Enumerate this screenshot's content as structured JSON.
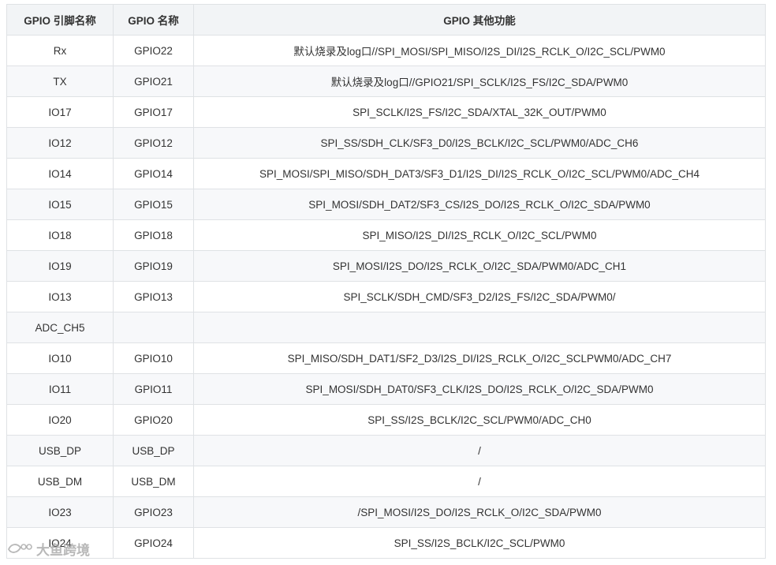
{
  "table": {
    "headers": [
      "GPIO 引脚名称",
      "GPIO 名称",
      "GPIO 其他功能"
    ],
    "rows": [
      [
        "Rx",
        "GPIO22",
        "默认烧录及log口//SPI_MOSI/SPI_MISO/I2S_DI/I2S_RCLK_O/I2C_SCL/PWM0"
      ],
      [
        "TX",
        "GPIO21",
        "默认烧录及log口//GPIO21/SPI_SCLK/I2S_FS/I2C_SDA/PWM0"
      ],
      [
        "IO17",
        "GPIO17",
        "SPI_SCLK/I2S_FS/I2C_SDA/XTAL_32K_OUT/PWM0"
      ],
      [
        "IO12",
        "GPIO12",
        "SPI_SS/SDH_CLK/SF3_D0/I2S_BCLK/I2C_SCL/PWM0/ADC_CH6"
      ],
      [
        "IO14",
        "GPIO14",
        "SPI_MOSI/SPI_MISO/SDH_DAT3/SF3_D1/I2S_DI/I2S_RCLK_O/I2C_SCL/PWM0/ADC_CH4"
      ],
      [
        "IO15",
        "GPIO15",
        "SPI_MOSI/SDH_DAT2/SF3_CS/I2S_DO/I2S_RCLK_O/I2C_SDA/PWM0"
      ],
      [
        "IO18",
        "GPIO18",
        "SPI_MISO/I2S_DI/I2S_RCLK_O/I2C_SCL/PWM0"
      ],
      [
        "IO19",
        "GPIO19",
        "SPI_MOSI/I2S_DO/I2S_RCLK_O/I2C_SDA/PWM0/ADC_CH1"
      ],
      [
        "IO13",
        "GPIO13",
        "SPI_SCLK/SDH_CMD/SF3_D2/I2S_FS/I2C_SDA/PWM0/"
      ],
      [
        "ADC_CH5",
        "",
        ""
      ],
      [
        "IO10",
        "GPIO10",
        "SPI_MISO/SDH_DAT1/SF2_D3/I2S_DI/I2S_RCLK_O/I2C_SCLPWM0/ADC_CH7"
      ],
      [
        "IO11",
        "GPIO11",
        "SPI_MOSI/SDH_DAT0/SF3_CLK/I2S_DO/I2S_RCLK_O/I2C_SDA/PWM0"
      ],
      [
        "IO20",
        "GPIO20",
        "SPI_SS/I2S_BCLK/I2C_SCL/PWM0/ADC_CH0"
      ],
      [
        "USB_DP",
        "USB_DP",
        "/"
      ],
      [
        "USB_DM",
        "USB_DM",
        "/"
      ],
      [
        "IO23",
        "GPIO23",
        "/SPI_MOSI/I2S_DO/I2S_RCLK_O/I2C_SDA/PWM0"
      ],
      [
        "IO24",
        "GPIO24",
        "SPI_SS/I2S_BCLK/I2C_SCL/PWM0"
      ]
    ]
  },
  "watermark": {
    "text": "大鱼跨境"
  },
  "colors": {
    "header_bg": "#f2f4f6",
    "border": "#dfe2e5",
    "stripe_bg": "#f7f8fa",
    "text": "#333333"
  }
}
